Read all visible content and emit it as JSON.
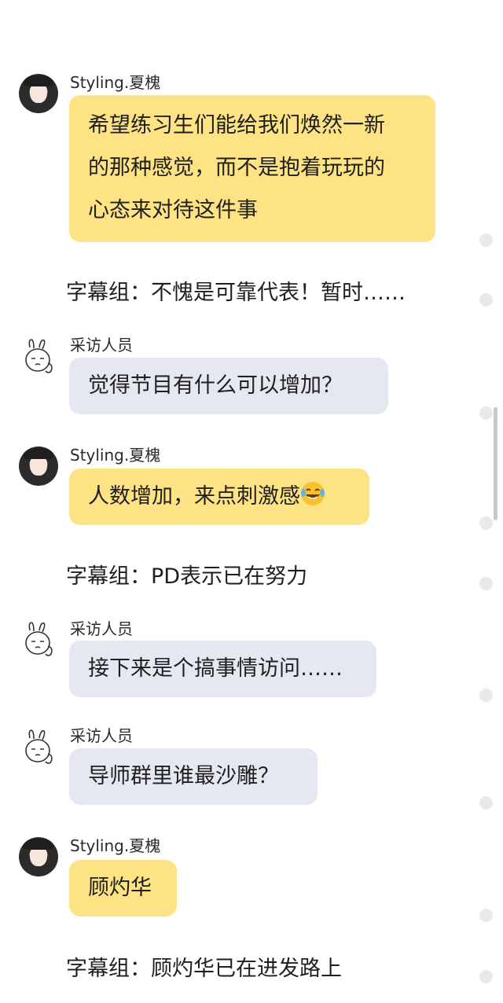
{
  "messages": [
    {
      "sender": "Styling.夏槐",
      "text_lines": [
        "希望练习生们能给我们焕然一新",
        "的那种感觉，而不是抱着玩玩的",
        "心态来对待这件事"
      ]
    },
    {
      "caption": "字幕组：不愧是可靠代表！暂时……"
    },
    {
      "sender": "采访人员",
      "text": "觉得节目有什么可以增加？"
    },
    {
      "sender": "Styling.夏槐",
      "text": "人数增加，来点刺激感",
      "emoji": "laughing-tears-emoji"
    },
    {
      "caption": "字幕组：PD表示已在努力"
    },
    {
      "sender": "采访人员",
      "text": "接下来是个搞事情访问……"
    },
    {
      "sender": "采访人员",
      "text": "导师群里谁最沙雕？"
    },
    {
      "sender": "Styling.夏槐",
      "text": "顾灼华"
    },
    {
      "caption": "字幕组：顾灼华已在进发路上"
    }
  ],
  "colors": {
    "bubble_yellow": "#fde383",
    "bubble_gray": "#e5e8f0",
    "dot": "#e9e9e9",
    "scrollbar": "#c9c9c9"
  },
  "icons": {
    "girl_avatar": "girl-avatar",
    "rabbit_avatar": "rabbit-avatar"
  }
}
